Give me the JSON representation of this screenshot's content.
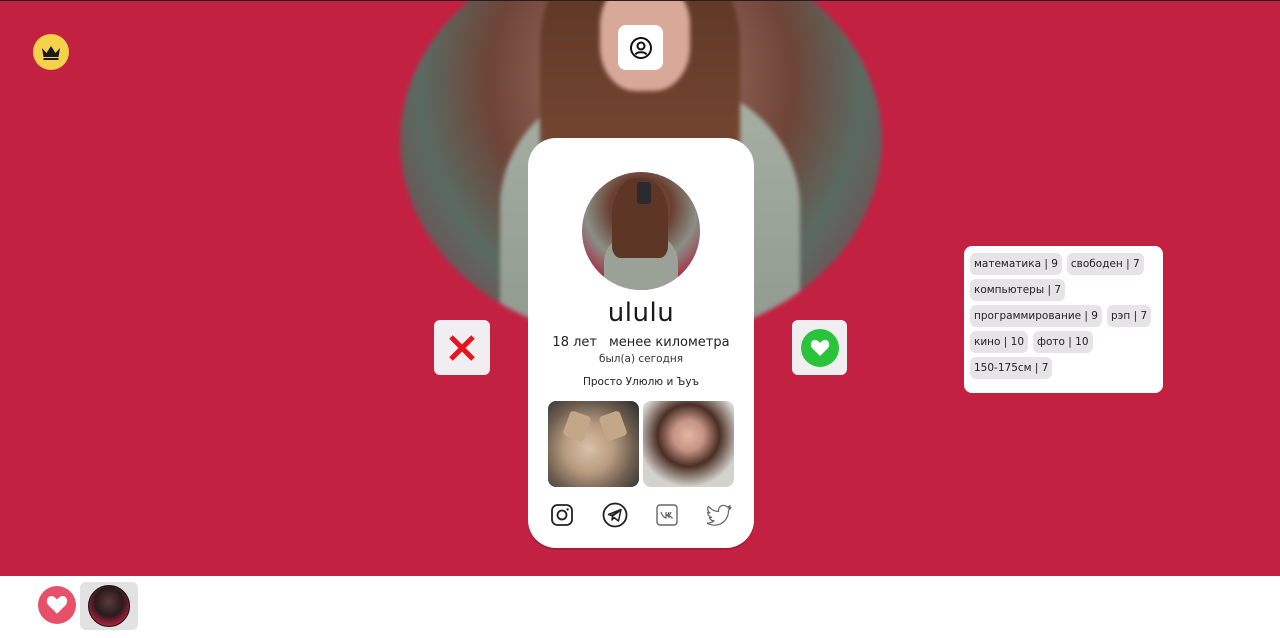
{
  "colors": {
    "accent": "#c32142",
    "crown": "#f6d24a",
    "like": "#2ac43c",
    "nope": "#e8131d",
    "likes_button": "#e8506a"
  },
  "icons": {
    "crown": "crown-icon",
    "profile": "user-circle-icon",
    "nope": "close-icon",
    "like": "heart-icon",
    "instagram": "instagram-icon",
    "telegram": "telegram-icon",
    "vk": "vk-icon",
    "twitter": "twitter-icon"
  },
  "profile": {
    "name": "ululu",
    "age": "18 лет",
    "distance": "менее километра",
    "last_seen": "был(а) сегодня",
    "bio": "Просто Улюлю и Ъуъ"
  },
  "interests": [
    [
      "математика | 9",
      "свободен | 7"
    ],
    [
      "компьютеры | 7"
    ],
    [
      "программирование | 9",
      "рэп | 7"
    ],
    [
      "кино | 10",
      "фото | 10"
    ],
    [
      "150-175см | 7"
    ]
  ]
}
